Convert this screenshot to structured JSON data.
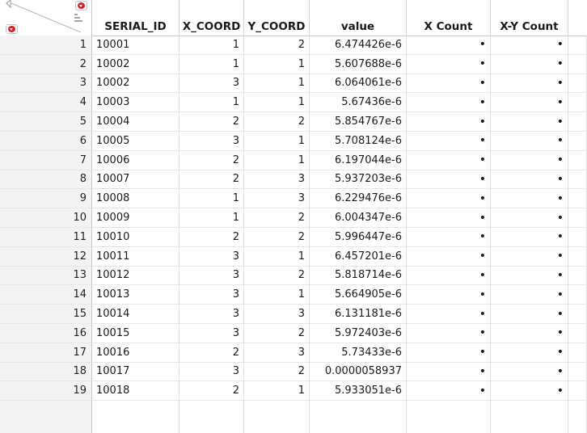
{
  "columns": [
    {
      "key": "serial_id",
      "label": "SERIAL_ID"
    },
    {
      "key": "x_coord",
      "label": "X_COORD"
    },
    {
      "key": "y_coord",
      "label": "Y_COORD"
    },
    {
      "key": "value",
      "label": "value"
    },
    {
      "key": "x_count",
      "label": "X Count"
    },
    {
      "key": "xy_count",
      "label": "X-Y Count"
    }
  ],
  "rows": [
    {
      "n": "1",
      "serial_id": "10001",
      "x_coord": "1",
      "y_coord": "2",
      "value": "6.474426e-6",
      "x_count": "•",
      "xy_count": "•"
    },
    {
      "n": "2",
      "serial_id": "10002",
      "x_coord": "1",
      "y_coord": "1",
      "value": "5.607688e-6",
      "x_count": "•",
      "xy_count": "•"
    },
    {
      "n": "3",
      "serial_id": "10002",
      "x_coord": "3",
      "y_coord": "1",
      "value": "6.064061e-6",
      "x_count": "•",
      "xy_count": "•"
    },
    {
      "n": "4",
      "serial_id": "10003",
      "x_coord": "1",
      "y_coord": "1",
      "value": "5.67436e-6",
      "x_count": "•",
      "xy_count": "•"
    },
    {
      "n": "5",
      "serial_id": "10004",
      "x_coord": "2",
      "y_coord": "2",
      "value": "5.854767e-6",
      "x_count": "•",
      "xy_count": "•"
    },
    {
      "n": "6",
      "serial_id": "10005",
      "x_coord": "3",
      "y_coord": "1",
      "value": "5.708124e-6",
      "x_count": "•",
      "xy_count": "•"
    },
    {
      "n": "7",
      "serial_id": "10006",
      "x_coord": "2",
      "y_coord": "1",
      "value": "6.197044e-6",
      "x_count": "•",
      "xy_count": "•"
    },
    {
      "n": "8",
      "serial_id": "10007",
      "x_coord": "2",
      "y_coord": "3",
      "value": "5.937203e-6",
      "x_count": "•",
      "xy_count": "•"
    },
    {
      "n": "9",
      "serial_id": "10008",
      "x_coord": "1",
      "y_coord": "3",
      "value": "6.229476e-6",
      "x_count": "•",
      "xy_count": "•"
    },
    {
      "n": "10",
      "serial_id": "10009",
      "x_coord": "1",
      "y_coord": "2",
      "value": "6.004347e-6",
      "x_count": "•",
      "xy_count": "•"
    },
    {
      "n": "11",
      "serial_id": "10010",
      "x_coord": "2",
      "y_coord": "2",
      "value": "5.996447e-6",
      "x_count": "•",
      "xy_count": "•"
    },
    {
      "n": "12",
      "serial_id": "10011",
      "x_coord": "3",
      "y_coord": "1",
      "value": "6.457201e-6",
      "x_count": "•",
      "xy_count": "•"
    },
    {
      "n": "13",
      "serial_id": "10012",
      "x_coord": "3",
      "y_coord": "2",
      "value": "5.818714e-6",
      "x_count": "•",
      "xy_count": "•"
    },
    {
      "n": "14",
      "serial_id": "10013",
      "x_coord": "3",
      "y_coord": "1",
      "value": "5.664905e-6",
      "x_count": "•",
      "xy_count": "•"
    },
    {
      "n": "15",
      "serial_id": "10014",
      "x_coord": "3",
      "y_coord": "3",
      "value": "6.131181e-6",
      "x_count": "•",
      "xy_count": "•"
    },
    {
      "n": "16",
      "serial_id": "10015",
      "x_coord": "3",
      "y_coord": "2",
      "value": "5.972403e-6",
      "x_count": "•",
      "xy_count": "•"
    },
    {
      "n": "17",
      "serial_id": "10016",
      "x_coord": "2",
      "y_coord": "3",
      "value": "5.73433e-6",
      "x_count": "•",
      "xy_count": "•"
    },
    {
      "n": "18",
      "serial_id": "10017",
      "x_coord": "3",
      "y_coord": "2",
      "value": "0.0000058937",
      "x_count": "•",
      "xy_count": "•"
    },
    {
      "n": "19",
      "serial_id": "10018",
      "x_coord": "2",
      "y_coord": "1",
      "value": "5.933051e-6",
      "x_count": "•",
      "xy_count": "•"
    }
  ],
  "icons": {
    "corner_triangle": "table-corner-triangle-icon",
    "table_menu": "red-triangle-menu-icon",
    "rows_menu": "red-triangle-rows-menu-icon",
    "columns_menu": "red-triangle-columns-menu-icon",
    "sort": "sort-lines-icon"
  },
  "colors": {
    "accent_red": "#d8202a",
    "row_header_bg": "#f3f3f3",
    "grid_line": "#e0e0e0"
  }
}
